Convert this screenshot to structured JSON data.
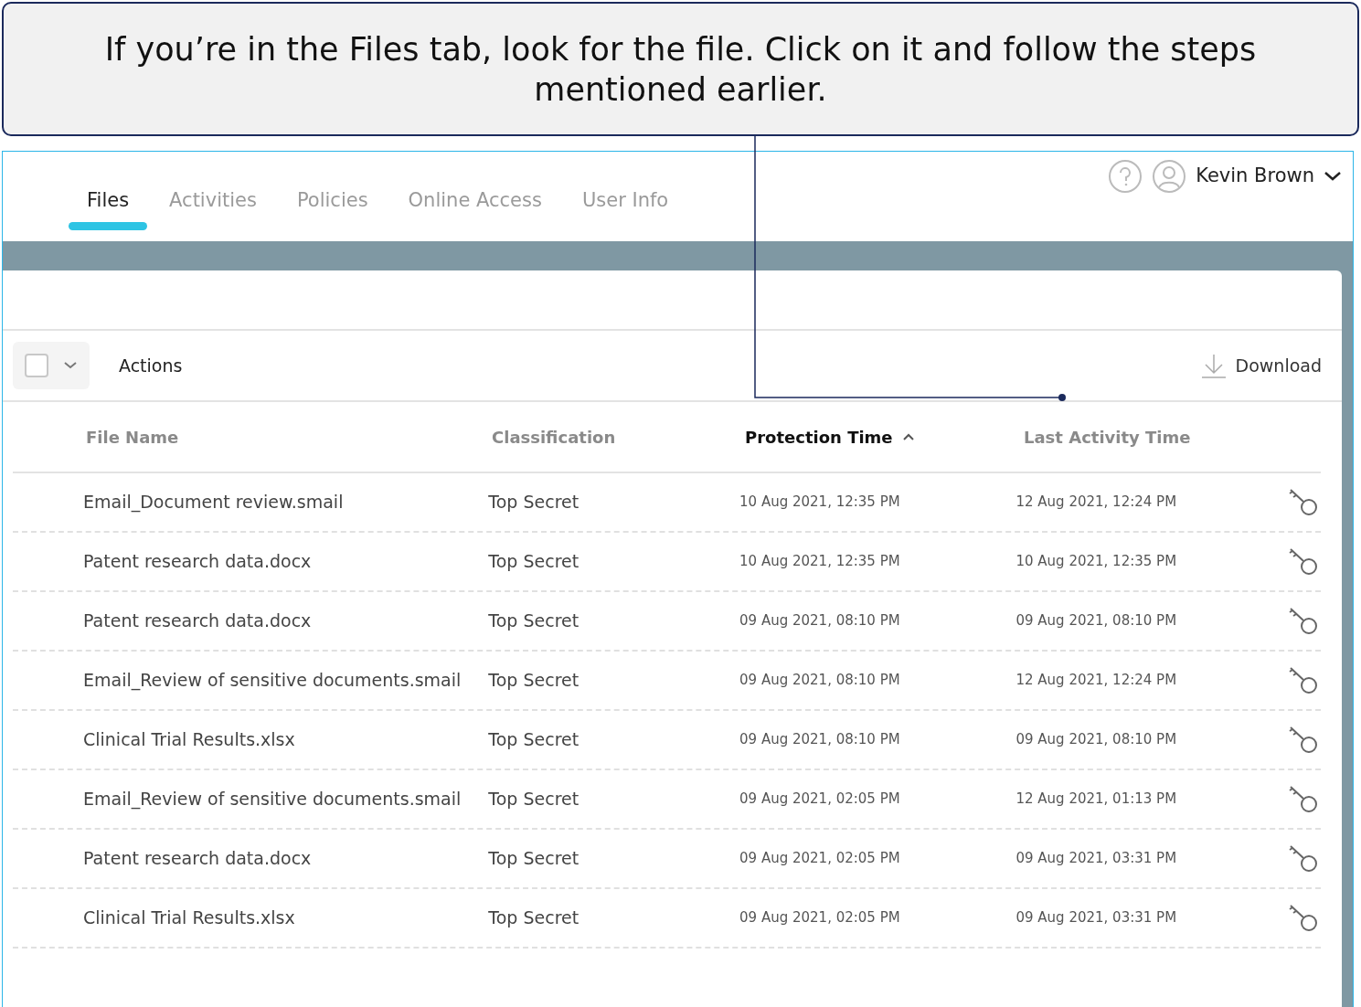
{
  "callout": {
    "text": "If you’re in the Files tab, look for the file. Click on it and follow the steps mentioned earlier."
  },
  "tabs": [
    {
      "label": "Files",
      "selected": true
    },
    {
      "label": "Activities",
      "selected": false
    },
    {
      "label": "Policies",
      "selected": false
    },
    {
      "label": "Online Access",
      "selected": false
    },
    {
      "label": "User Info",
      "selected": false
    }
  ],
  "user": {
    "name": "Kevin Brown"
  },
  "toolbar": {
    "select_all_checked": false,
    "actions": "Actions",
    "download": "Download"
  },
  "table": {
    "columns": [
      {
        "label": "File Name",
        "sorted": false
      },
      {
        "label": "Classification",
        "sorted": false
      },
      {
        "label": "Protection Time",
        "sorted": true
      },
      {
        "label": "Last Activity Time",
        "sorted": false
      }
    ],
    "rows": [
      {
        "name": "Email_Document review.smail",
        "classification": "Top Secret",
        "protection_time": "10 Aug 2021, 12:35 PM",
        "last_activity": "12 Aug 2021, 12:24 PM"
      },
      {
        "name": "Patent research data.docx",
        "classification": "Top Secret",
        "protection_time": "10 Aug 2021, 12:35 PM",
        "last_activity": "10 Aug 2021, 12:35 PM"
      },
      {
        "name": "Patent research data.docx",
        "classification": "Top Secret",
        "protection_time": "09 Aug 2021, 08:10 PM",
        "last_activity": "09 Aug 2021, 08:10 PM"
      },
      {
        "name": "Email_Review of sensitive documents.smail",
        "classification": "Top Secret",
        "protection_time": "09 Aug 2021, 08:10 PM",
        "last_activity": "12 Aug 2021, 12:24 PM"
      },
      {
        "name": "Clinical Trial Results.xlsx",
        "classification": "Top Secret",
        "protection_time": "09 Aug 2021, 08:10 PM",
        "last_activity": "09 Aug 2021, 08:10 PM"
      },
      {
        "name": "Email_Review of sensitive documents.smail",
        "classification": "Top Secret",
        "protection_time": "09 Aug 2021, 02:05 PM",
        "last_activity": "12 Aug 2021, 01:13 PM"
      },
      {
        "name": "Patent research data.docx",
        "classification": "Top Secret",
        "protection_time": "09 Aug 2021, 02:05 PM",
        "last_activity": "09 Aug 2021, 03:31 PM"
      },
      {
        "name": "Clinical Trial Results.xlsx",
        "classification": "Top Secret",
        "protection_time": "09 Aug 2021, 02:05 PM",
        "last_activity": "09 Aug 2021, 03:31 PM"
      }
    ]
  }
}
